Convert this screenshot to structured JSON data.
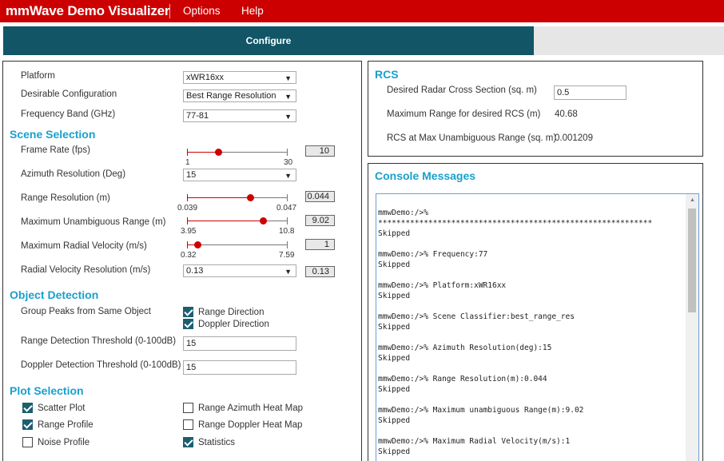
{
  "header": {
    "title": "mmWave Demo Visualizer",
    "menu": [
      "Options",
      "Help"
    ]
  },
  "tabs": {
    "active": "Configure"
  },
  "config": {
    "platform_label": "Platform",
    "platform_value": "xWR16xx",
    "desirable_label": "Desirable Configuration",
    "desirable_value": "Best Range Resolution",
    "freq_label": "Frequency Band (GHz)",
    "freq_value": "77-81"
  },
  "scene": {
    "title": "Scene Selection",
    "frame_rate": {
      "label": "Frame Rate (fps)",
      "min": "1",
      "max": "30",
      "value": "10",
      "fraction": 0.31
    },
    "azimuth_label": "Azimuth Resolution (Deg)",
    "azimuth_value": "15",
    "range_res": {
      "label": "Range Resolution (m)",
      "min": "0.039",
      "max": "0.047",
      "value": "0.044",
      "fraction": 0.63
    },
    "max_range": {
      "label": "Maximum Unambiguous Range (m)",
      "min": "3.95",
      "max": "10.8",
      "value": "9.02",
      "fraction": 0.75
    },
    "max_velocity": {
      "label": "Maximum Radial Velocity (m/s)",
      "min": "0.32",
      "max": "7.59",
      "value": "1",
      "fraction": 0.1
    },
    "vel_res_label": "Radial Velocity Resolution (m/s)",
    "vel_res_select": "0.13",
    "vel_res_value": "0.13"
  },
  "object_detection": {
    "title": "Object Detection",
    "group_peaks_label": "Group Peaks from Same Object",
    "range_direction": {
      "label": "Range Direction",
      "checked": true
    },
    "doppler_direction": {
      "label": "Doppler Direction",
      "checked": true
    },
    "range_threshold_label": "Range Detection Threshold (0-100dB)",
    "range_threshold_value": "15",
    "doppler_threshold_label": "Doppler Detection Threshold (0-100dB)",
    "doppler_threshold_value": "15"
  },
  "plot_selection": {
    "title": "Plot Selection",
    "scatter": {
      "label": "Scatter Plot",
      "checked": true
    },
    "range_azimuth": {
      "label": "Range Azimuth Heat Map",
      "checked": false
    },
    "range_profile": {
      "label": "Range Profile",
      "checked": true
    },
    "range_doppler": {
      "label": "Range Doppler Heat Map",
      "checked": false
    },
    "noise_profile": {
      "label": "Noise Profile",
      "checked": false
    },
    "statistics": {
      "label": "Statistics",
      "checked": true
    }
  },
  "rcs": {
    "title": "RCS",
    "desired_label": "Desired Radar Cross Section (sq. m)",
    "desired_value": "0.5",
    "max_range_label": "Maximum Range for desired RCS (m)",
    "max_range_value": "40.68",
    "rcs_unamb_label": "RCS at Max Unambiguous Range (sq. m)",
    "rcs_unamb_value": "0.001209"
  },
  "console": {
    "title": "Console Messages",
    "lines": [
      "mmwDemo:/>%",
      "************************************************************",
      "Skipped",
      "",
      "mmwDemo:/>% Frequency:77",
      "Skipped",
      "",
      "mmwDemo:/>% Platform:xWR16xx",
      "Skipped",
      "",
      "mmwDemo:/>% Scene Classifier:best_range_res",
      "Skipped",
      "",
      "mmwDemo:/>% Azimuth Resolution(deg):15",
      "Skipped",
      "",
      "mmwDemo:/>% Range Resolution(m):0.044",
      "Skipped",
      "",
      "mmwDemo:/>% Maximum unambiguous Range(m):9.02",
      "Skipped",
      "",
      "mmwDemo:/>% Maximum Radial Velocity(m/s):1",
      "Skipped"
    ]
  },
  "icons": {
    "dropdown": "chevron-down-icon",
    "check": "check-icon",
    "scroll_up": "scroll-up-arrow-icon"
  },
  "colors": {
    "brand_red": "#cc0000",
    "tab_active": "#115566",
    "section_title": "#1aa0cc"
  }
}
